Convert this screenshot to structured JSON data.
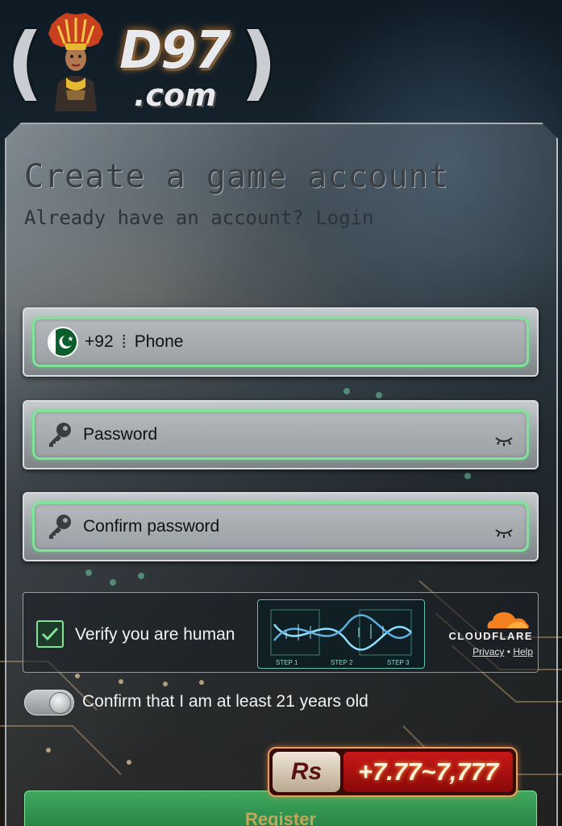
{
  "logo": {
    "brand": "D97",
    "domain": ".com"
  },
  "form": {
    "title": "Create a game account",
    "subtitle_prefix": "Already have an account? ",
    "login_link": "Login",
    "phone": {
      "country_code": "+92",
      "placeholder": "Phone",
      "flag": "pakistan-flag-icon"
    },
    "password": {
      "placeholder": "Password",
      "icon": "key-icon",
      "toggle_icon": "eye-closed-icon"
    },
    "confirm_password": {
      "placeholder": "Confirm password",
      "icon": "key-icon",
      "toggle_icon": "eye-closed-icon"
    }
  },
  "captcha": {
    "label": "Verify you are human",
    "checked": true,
    "steps": [
      "STEP 1",
      "STEP 2",
      "STEP 3"
    ],
    "provider": "CLOUDFLARE",
    "privacy": "Privacy",
    "dot": " • ",
    "help": "Help"
  },
  "age_confirm": {
    "label": "Confirm that I am at least 21 years old"
  },
  "bonus": {
    "currency": "Rs",
    "amount": "+7.77~7,777"
  },
  "register_label": "Register",
  "colors": {
    "accent_green": "#7fe39a",
    "bonus_red": "#c81818",
    "cloudflare_orange": "#f48120"
  }
}
